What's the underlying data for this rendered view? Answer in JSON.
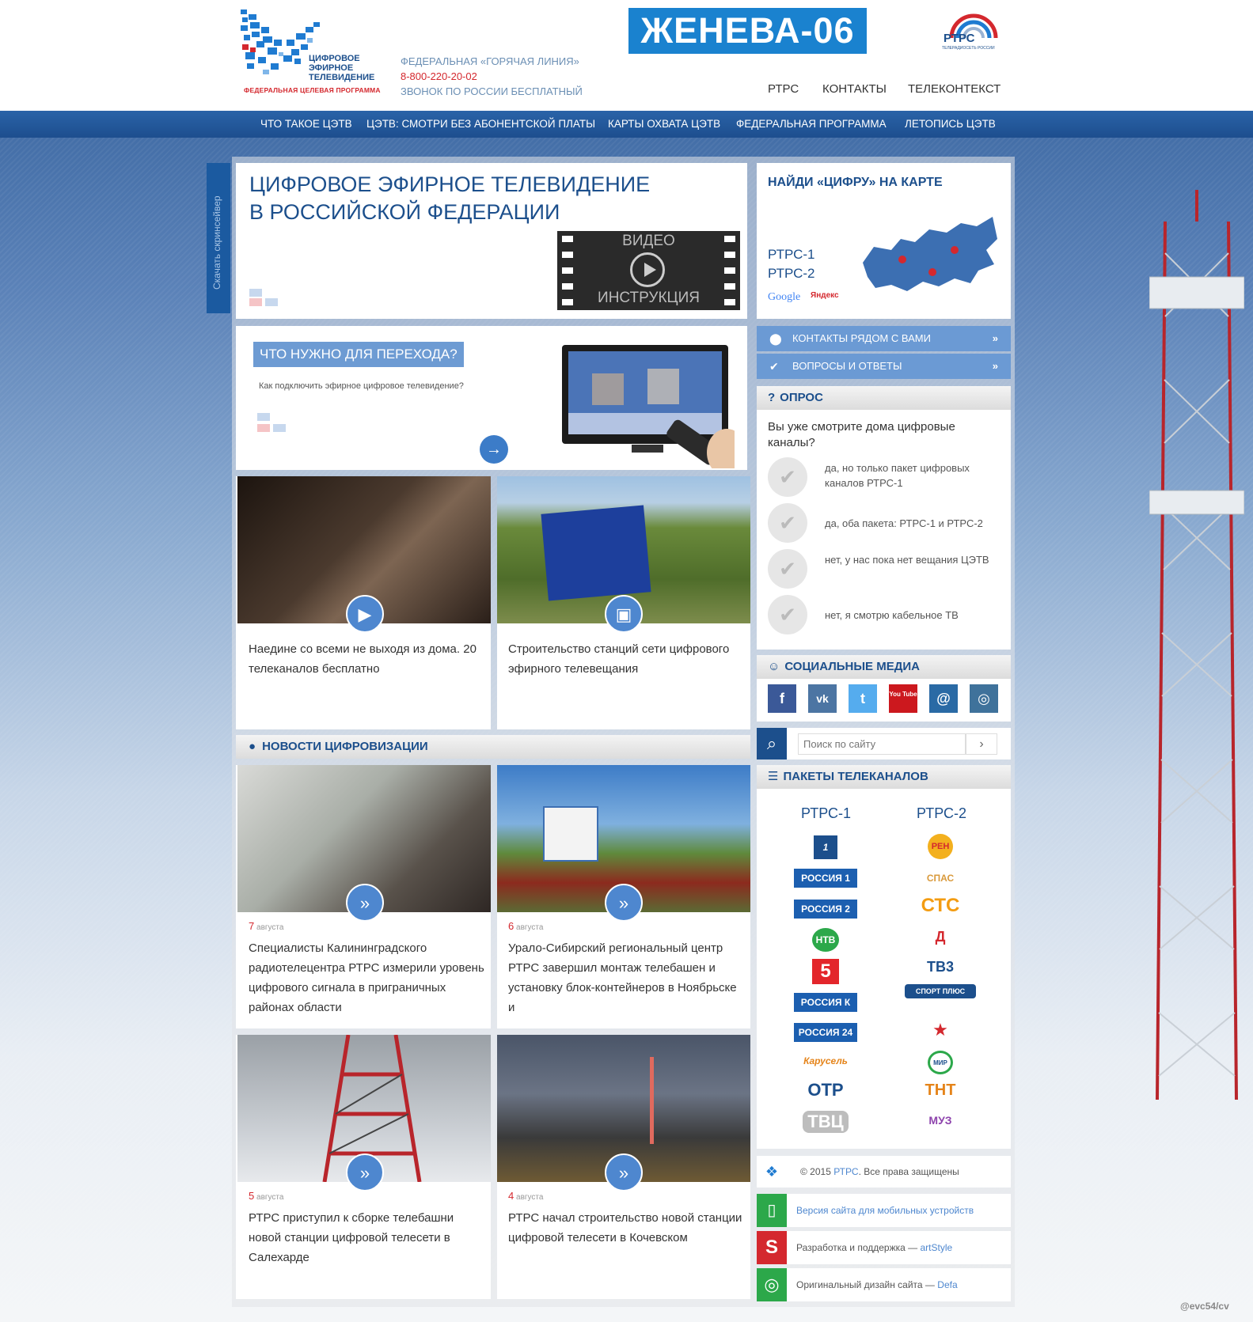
{
  "header": {
    "logo_lines": [
      "ЦИФРОВОЕ",
      "ЭФИРНОЕ",
      "ТЕЛЕВИДЕНИЕ"
    ],
    "logo_sub": "ФЕДЕРАЛЬНАЯ ЦЕЛЕВАЯ ПРОГРАММА",
    "hotline_label": "ФЕДЕРАЛЬНАЯ «ГОРЯЧАЯ ЛИНИЯ»",
    "hotline_phone": "8-800-220-20-02",
    "hotline_note": "ЗВОНОК ПО РОССИИ БЕСПЛАТНЫЙ",
    "banner": "ЖЕНЕВА-06",
    "rtrs_logo": "РТРС",
    "rtrs_logo_sub": "ТЕЛЕРАДИОСЕТЬ РОССИИ",
    "links": [
      "РТРС",
      "КОНТАКТЫ",
      "ТЕЛЕКОНТЕКСТ"
    ]
  },
  "nav": [
    "ЧТО ТАКОЕ ЦЭТВ",
    "ЦЭТВ: СМОТРИ БЕЗ АБОНЕНТСКОЙ ПЛАТЫ",
    "КАРТЫ ОХВАТА ЦЭТВ",
    "ФЕДЕРАЛЬНАЯ ПРОГРАММА",
    "ЛЕТОПИСЬ ЦЭТВ"
  ],
  "screenreader": "Скачать скринсейвер",
  "hero": {
    "title_line1": "ЦИФРОВОЕ ЭФИРНОЕ ТЕЛЕВИДЕНИЕ",
    "title_line2": "В РОССИЙСКОЙ ФЕДЕРАЦИИ",
    "video_top": "ВИДЕО",
    "video_bottom": "ИНСТРУКЦИЯ"
  },
  "transition": {
    "title": "ЧТО НУЖНО ДЛЯ ПЕРЕХОДА?",
    "subtitle": "Как подключить эфирное цифровое телевидение?"
  },
  "features": [
    {
      "text": "Наедине со всеми не выходя из дома. 20 телеканалов бесплатно",
      "icon": "play-icon"
    },
    {
      "text": "Строительство станций сети цифрового эфирного телевещания",
      "icon": "image-icon"
    }
  ],
  "news": {
    "title": "НОВОСТИ ЦИФРОВИЗАЦИИ",
    "items": [
      {
        "day": "7",
        "month": "августа",
        "text": "Специалисты Калининградского радиотелецентра РТРС измерили уровень цифрового сигнала в приграничных районах области"
      },
      {
        "day": "6",
        "month": "августа",
        "text": "Урало-Сибирский региональный центр РТРС завершил монтаж телебашен и установку блок-контейнеров в Ноябрьске и"
      },
      {
        "day": "5",
        "month": "августа",
        "text": "РТРС приступил к сборке телебашни новой станции цифровой телесети в Салехарде"
      },
      {
        "day": "4",
        "month": "августа",
        "text": "РТРС начал строительство новой станции цифровой телесети в Кочевском"
      }
    ]
  },
  "map": {
    "title": "НАЙДИ «ЦИФРУ» НА КАРТЕ",
    "mux1": "РТРС-1",
    "mux2": "РТРС-2",
    "google": "Google",
    "yandex": "Яндекс"
  },
  "side_links": [
    "КОНТАКТЫ РЯДОМ С ВАМИ",
    "ВОПРОСЫ И ОТВЕТЫ"
  ],
  "poll": {
    "title": "ОПРОС",
    "question": "Вы уже смотрите дома цифровые каналы?",
    "options": [
      "да, но только пакет цифровых каналов РТРС-1",
      "да, оба пакета: РТРС-1 и РТРС-2",
      "нет, у нас пока нет вещания ЦЭТВ",
      "нет, я смотрю кабельное ТВ"
    ]
  },
  "social": {
    "title": "СОЦИАЛЬНЫЕ МЕДИА",
    "items": [
      {
        "name": "facebook-icon",
        "glyph": "f",
        "color": "#3b5998"
      },
      {
        "name": "vk-icon",
        "glyph": "vk",
        "color": "#4c75a3"
      },
      {
        "name": "twitter-icon",
        "glyph": "t",
        "color": "#55acee"
      },
      {
        "name": "youtube-icon",
        "glyph": "You Tube",
        "color": "#cc181e"
      },
      {
        "name": "ok-icon",
        "glyph": "@",
        "color": "#2a6aa5"
      },
      {
        "name": "instagram-icon",
        "glyph": "◎",
        "color": "#3f729b"
      }
    ]
  },
  "search": {
    "placeholder": "Поиск по сайту",
    "button": "›"
  },
  "packages": {
    "title": "ПАКЕТЫ ТЕЛЕКАНАЛОВ",
    "mux1_title": "РТРС-1",
    "mux2_title": "РТРС-2",
    "mux1": [
      "1",
      "РОССИЯ 1",
      "РОССИЯ 2",
      "НТВ",
      "5",
      "РОССИЯ К",
      "РОССИЯ 24",
      "Карусель",
      "ОТР",
      "ТВЦ"
    ],
    "mux2": [
      "РЕН",
      "СПАС",
      "СТС",
      "Д",
      "ТВ3",
      "СПОРТ ПЛЮС",
      "★",
      "МИР",
      "ТНТ",
      "МУЗ"
    ]
  },
  "footer": {
    "copyright_pre": "© 2015",
    "copyright_link": "РТРС",
    "copyright_post": ". Все права защищены",
    "mobile": "Версия сайта для мобильных устройств",
    "dev_pre": "Разработка и поддержка —",
    "dev_link": "artStyle",
    "design_pre": "Оригинальный дизайн сайта —",
    "design_link": "Defa"
  },
  "watermark": "@evc54/cv",
  "colors": {
    "brand": "#1c4f8c",
    "accent": "#4e87cf",
    "red": "#d4282e",
    "nav": "#1d4e8e"
  }
}
